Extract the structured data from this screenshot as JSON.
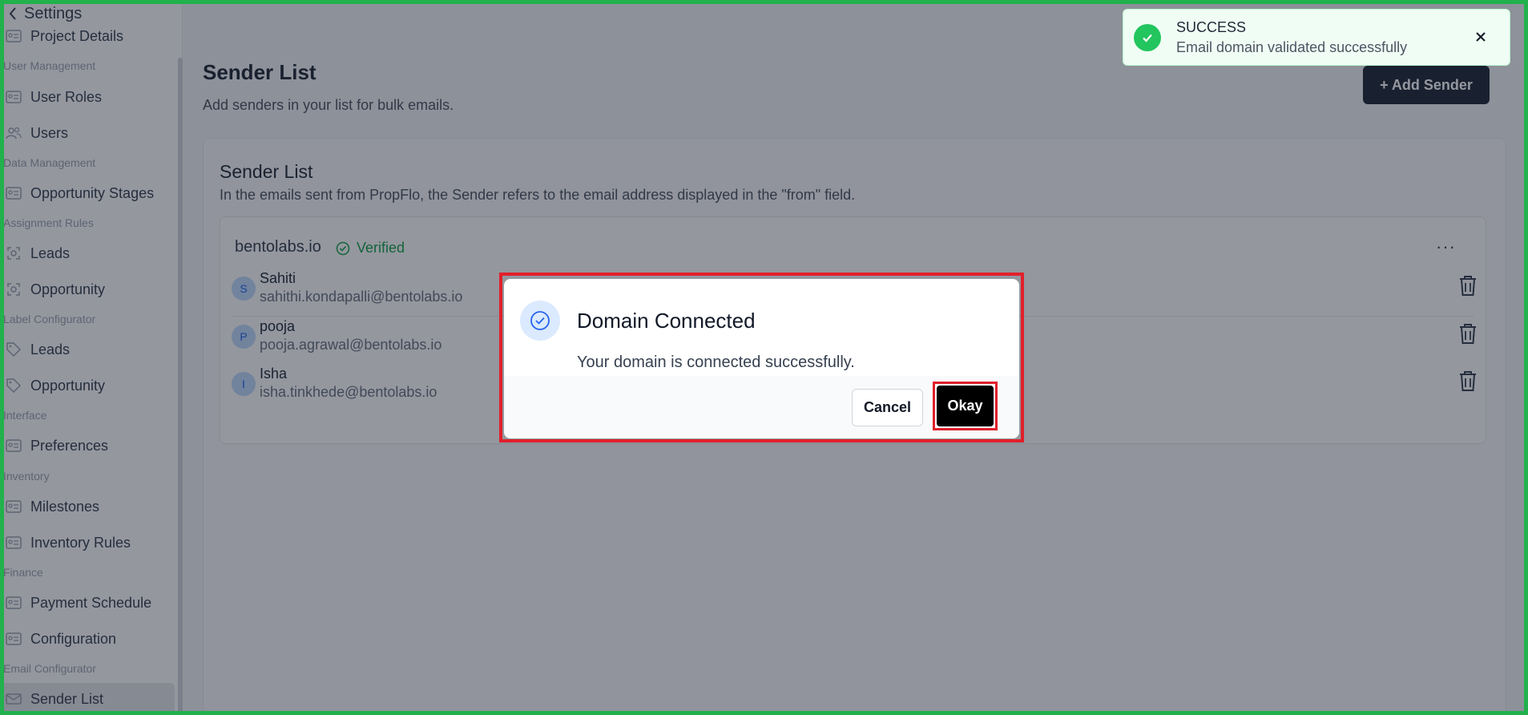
{
  "sidebar": {
    "back_label": "Settings",
    "items": [
      {
        "label": "Project Details",
        "icon": "id-card-icon"
      },
      {
        "section": "User Management"
      },
      {
        "label": "User Roles",
        "icon": "id-card-icon"
      },
      {
        "label": "Users",
        "icon": "users-icon"
      },
      {
        "section": "Data Management"
      },
      {
        "label": "Opportunity Stages",
        "icon": "id-card-icon"
      },
      {
        "section": "Assignment Rules"
      },
      {
        "label": "Leads",
        "icon": "target-icon"
      },
      {
        "label": "Opportunity",
        "icon": "target-icon"
      },
      {
        "section": "Label Configurator"
      },
      {
        "label": "Leads",
        "icon": "tag-icon"
      },
      {
        "label": "Opportunity",
        "icon": "tag-icon"
      },
      {
        "section": "Interface"
      },
      {
        "label": "Preferences",
        "icon": "id-card-icon"
      },
      {
        "section": "Inventory"
      },
      {
        "label": "Milestones",
        "icon": "id-card-icon"
      },
      {
        "label": "Inventory Rules",
        "icon": "id-card-icon"
      },
      {
        "section": "Finance"
      },
      {
        "label": "Payment Schedule",
        "icon": "id-card-icon"
      },
      {
        "label": "Configuration",
        "icon": "id-card-icon"
      },
      {
        "section": "Email Configurator"
      },
      {
        "label": "Sender List",
        "icon": "mail-icon",
        "active": true
      }
    ]
  },
  "main": {
    "title": "Sender List",
    "subtitle": "Add senders in your list for bulk emails.",
    "add_button": "+ Add Sender",
    "card": {
      "title": "Sender List",
      "description": "In the emails sent from PropFlo, the Sender refers to the email address displayed in the \"from\" field.",
      "domain": {
        "name": "bentolabs.io",
        "status": "Verified",
        "more": "···",
        "senders": [
          {
            "initial": "S",
            "name": "Sahiti",
            "email": "sahithi.kondapalli@bentolabs.io"
          },
          {
            "initial": "P",
            "name": "pooja",
            "email": "pooja.agrawal@bentolabs.io"
          },
          {
            "initial": "I",
            "name": "Isha",
            "email": "isha.tinkhede@bentolabs.io"
          }
        ]
      }
    }
  },
  "modal": {
    "title": "Domain Connected",
    "message": "Your domain is connected successfully.",
    "cancel_label": "Cancel",
    "okay_label": "Okay"
  },
  "toast": {
    "title": "SUCCESS",
    "message": "Email domain validated successfully"
  },
  "colors": {
    "success": "#22c55e",
    "highlight_red": "#e0202b",
    "frame_green": "#22b14c",
    "primary_dark": "#1f2937"
  }
}
